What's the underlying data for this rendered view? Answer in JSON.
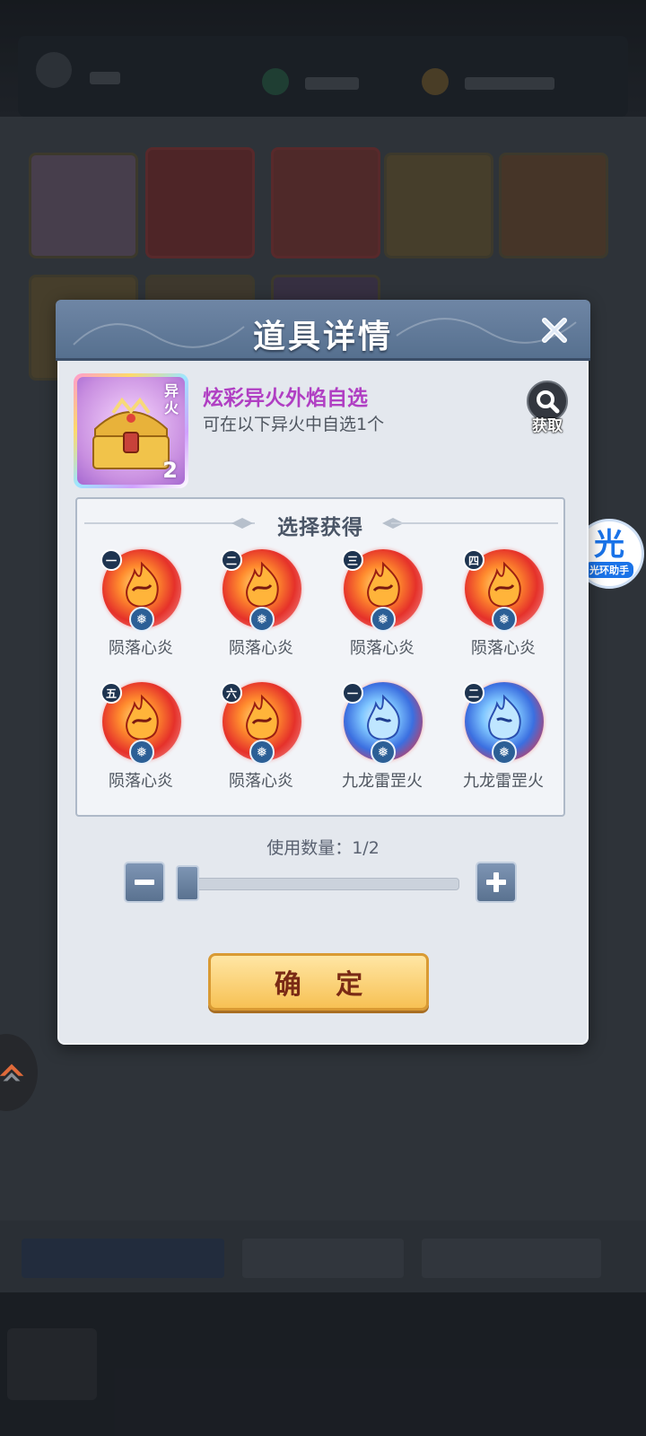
{
  "modal": {
    "title": "道具详情",
    "item": {
      "name": "炫彩异火外焰自选",
      "description": "可在以下异火中自选1个",
      "tag": "异火",
      "count": "2"
    },
    "obtain_label": "获取",
    "choice_title": "选择获得",
    "choices": [
      {
        "badge": "一",
        "label": "陨落心炎",
        "color": "fire"
      },
      {
        "badge": "二",
        "label": "陨落心炎",
        "color": "fire"
      },
      {
        "badge": "三",
        "label": "陨落心炎",
        "color": "fire"
      },
      {
        "badge": "四",
        "label": "陨落心炎",
        "color": "fire"
      },
      {
        "badge": "五",
        "label": "陨落心炎",
        "color": "fire"
      },
      {
        "badge": "六",
        "label": "陨落心炎",
        "color": "fire"
      },
      {
        "badge": "一",
        "label": "九龙雷罡火",
        "color": "blue"
      },
      {
        "badge": "二",
        "label": "九龙雷罡火",
        "color": "blue"
      }
    ],
    "quantity_label": "使用数量：1/2",
    "quantity": {
      "current": 1,
      "max": 2
    },
    "confirm_label": "确 定"
  },
  "assistant": {
    "glyph": "光",
    "caption": "光环助手"
  },
  "colors": {
    "header": "#6f86a5",
    "item_name": "#b03fc3",
    "confirm_bg": "#f7c154",
    "confirm_text": "#7a2a15"
  }
}
